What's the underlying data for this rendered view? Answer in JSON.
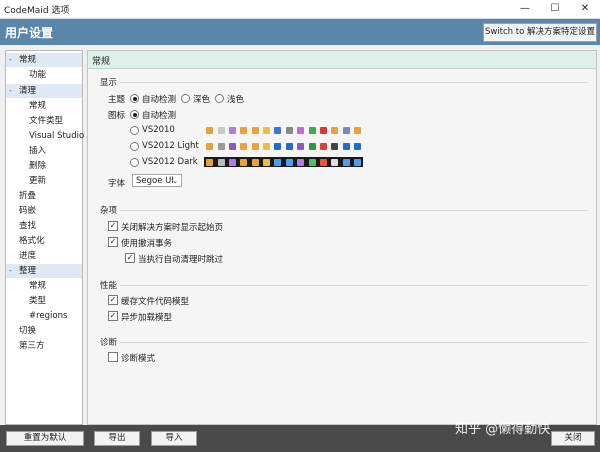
{
  "window": {
    "title": "CodeMaid 选项",
    "minimize": "—",
    "maximize": "☐",
    "close": "✕"
  },
  "header": {
    "title": "用户设置",
    "switch_label": "Switch to 解决方案特定设置"
  },
  "sidebar": {
    "items": [
      {
        "label": "常规",
        "exp": "-"
      },
      {
        "label": "功能"
      },
      {
        "label": "清理",
        "exp": "-"
      },
      {
        "label": "常规"
      },
      {
        "label": "文件类型"
      },
      {
        "label": "Visual Studio"
      },
      {
        "label": "插入"
      },
      {
        "label": "删除"
      },
      {
        "label": "更新"
      },
      {
        "label": "折叠"
      },
      {
        "label": "码嵌"
      },
      {
        "label": "查找"
      },
      {
        "label": "格式化"
      },
      {
        "label": "进度"
      },
      {
        "label": "整理",
        "exp": "-"
      },
      {
        "label": "常规"
      },
      {
        "label": "类型"
      },
      {
        "label": "#regions"
      },
      {
        "label": "切换"
      },
      {
        "label": "第三方"
      }
    ]
  },
  "panel": {
    "title": "常规",
    "display": {
      "section": "显示",
      "theme_label": "主题",
      "theme_options": [
        "自动检测",
        "深色",
        "浅色"
      ],
      "icon_label": "图标",
      "icon_options": [
        "自动检测",
        "VS2010",
        "VS2012 Light",
        "VS2012 Dark"
      ],
      "font_label": "字体",
      "font_value": "Segoe UI"
    },
    "misc": {
      "section": "杂项",
      "opt1": "关闭解决方案时显示起始页",
      "opt2": "使用撤消事务",
      "opt3": "当执行自动清理时跳过"
    },
    "perf": {
      "section": "性能",
      "opt1": "缓存文件代码模型",
      "opt2": "异步加载模型"
    },
    "diag": {
      "section": "诊断",
      "opt1": "诊断模式"
    }
  },
  "footer": {
    "reset": "重置为默认",
    "export": "导出",
    "import": "导入",
    "close": "关闭"
  },
  "watermark": "知乎 @懒得勤快",
  "colors": {
    "header": "#5a86aa",
    "panel_header": "#ddf0ea",
    "footer": "#4a4a4a"
  }
}
